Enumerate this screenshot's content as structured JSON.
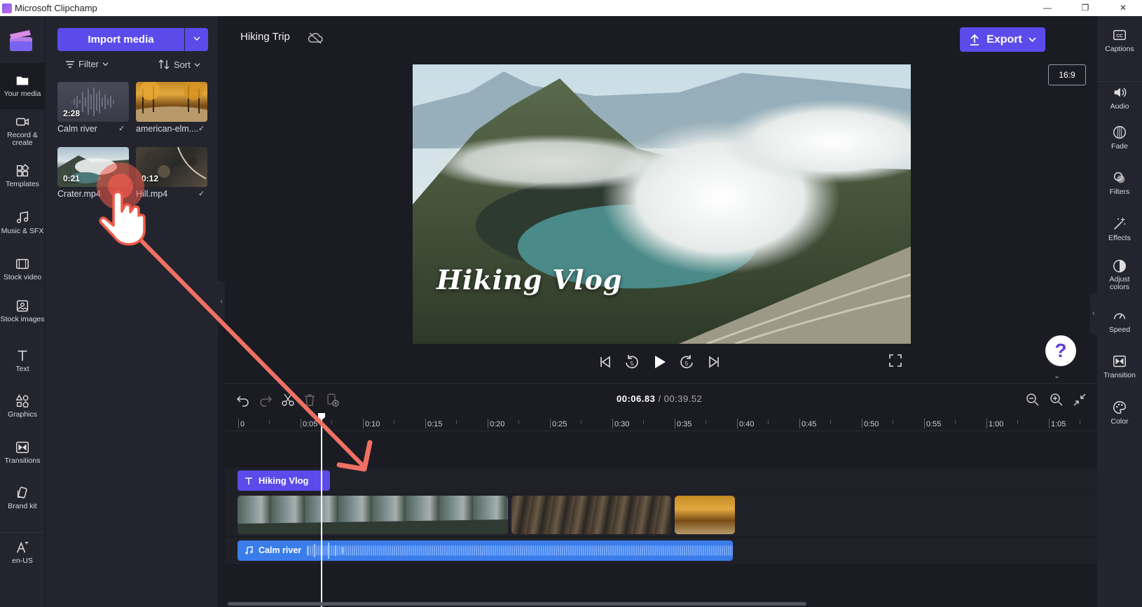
{
  "window": {
    "title": "Microsoft Clipchamp",
    "controls": [
      "—",
      "❐",
      "✕"
    ]
  },
  "left_nav": {
    "items": [
      {
        "label": "Your media",
        "icon": "folder-icon",
        "active": true
      },
      {
        "label": "Record & create",
        "icon": "camera-icon"
      },
      {
        "label": "Templates",
        "icon": "templates-icon"
      },
      {
        "label": "Music & SFX",
        "icon": "music-icon"
      },
      {
        "label": "Stock video",
        "icon": "film-icon"
      },
      {
        "label": "Stock images",
        "icon": "image-icon"
      },
      {
        "label": "Text",
        "icon": "text-icon"
      },
      {
        "label": "Graphics",
        "icon": "graphics-icon"
      },
      {
        "label": "Transitions",
        "icon": "transitions-icon"
      },
      {
        "label": "Brand kit",
        "icon": "brand-kit-icon"
      },
      {
        "label": "en-US",
        "icon": "language-icon"
      }
    ]
  },
  "media_panel": {
    "import_label": "Import media",
    "filter_label": "Filter",
    "sort_label": "Sort",
    "items": [
      {
        "name": "Calm river",
        "duration": "2:28",
        "checked": true,
        "kind": "audio"
      },
      {
        "name": "american-elm....",
        "duration": "",
        "checked": true,
        "kind": "image"
      },
      {
        "name": "Crater.mp4",
        "duration": "0:21",
        "checked": false,
        "kind": "video"
      },
      {
        "name": "Hill.mp4",
        "duration": "0:12",
        "checked": true,
        "kind": "video"
      }
    ]
  },
  "topbar": {
    "project_title": "Hiking Trip",
    "export_label": "Export",
    "aspect_ratio": "16:9"
  },
  "preview": {
    "overlay_text": "Hiking Vlog"
  },
  "help": {
    "label": "?"
  },
  "right_panel": {
    "items": [
      {
        "label": "Captions",
        "icon": "captions-icon"
      },
      {
        "label": "Audio",
        "icon": "speaker-icon"
      },
      {
        "label": "Fade",
        "icon": "fade-icon"
      },
      {
        "label": "Filters",
        "icon": "filters-icon"
      },
      {
        "label": "Effects",
        "icon": "magic-wand-icon"
      },
      {
        "label": "Adjust colors",
        "icon": "contrast-icon"
      },
      {
        "label": "Speed",
        "icon": "speedometer-icon"
      },
      {
        "label": "Transition",
        "icon": "transition-icon"
      },
      {
        "label": "Color",
        "icon": "palette-icon"
      }
    ]
  },
  "timeline": {
    "current_time": "00:06.83",
    "separator": " / ",
    "total_time": "00:39.52",
    "ruler": [
      "0",
      "0:05",
      "0:10",
      "0:15",
      "0:20",
      "0:25",
      "0:30",
      "0:35",
      "0:40",
      "0:45",
      "0:50",
      "0:55",
      "1:00",
      "1:05"
    ],
    "text_clip": "Hiking Vlog",
    "audio_clip": "Calm river"
  },
  "colors": {
    "accent": "#5b4bea",
    "audio_track": "#3a7dea",
    "background": "#1b1b23",
    "panel": "#24242e"
  }
}
